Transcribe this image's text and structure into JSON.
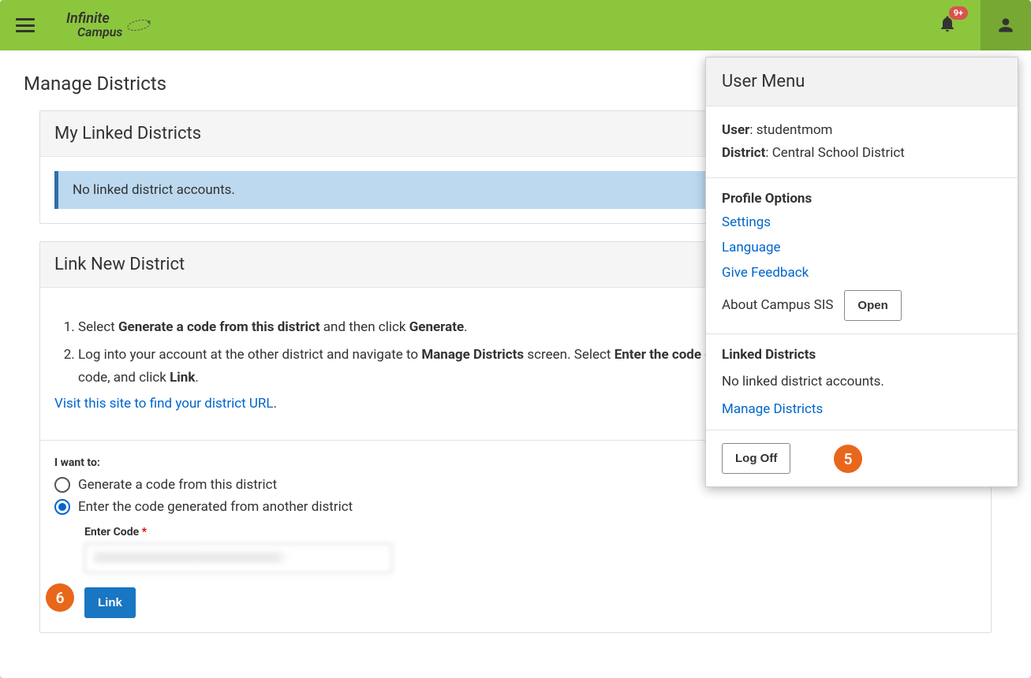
{
  "header": {
    "logo_top": "Infinite",
    "logo_bottom": "Campus",
    "badge": "9+"
  },
  "page_title": "Manage Districts",
  "linked_card": {
    "title": "My Linked Districts",
    "banner": "No linked district accounts."
  },
  "link_new_card": {
    "title": "Link New District",
    "step1_pre": "Select ",
    "step1_b1": "Generate a code from this district",
    "step1_mid": " and then click ",
    "step1_b2": "Generate",
    "step1_post": ".",
    "step2_pre": "Log into your account at the other district and navigate to ",
    "step2_b1": "Manage Districts",
    "step2_mid1": " screen. Select ",
    "step2_b2": "Enter the code generated from another district",
    "step2_mid2": ", enter the code, and click ",
    "step2_b3": "Link",
    "step2_post": ".",
    "visit_link": "Visit this site to find your district URL",
    "visit_post": ".",
    "i_want_to": "I want to:",
    "radio1": "Generate a code from this district",
    "radio2": "Enter the code generated from another district",
    "enter_code_label": "Enter Code ",
    "enter_code_req": "*",
    "code_value": "XXXXXXXXXXXXXXXXXXXXXXXX",
    "link_btn": "Link"
  },
  "user_menu": {
    "title": "User Menu",
    "user_label": "User",
    "user_value": ": studentmom",
    "district_label": "District",
    "district_value": ": Central School District",
    "profile_options": "Profile Options",
    "settings": "Settings",
    "language": "Language",
    "feedback": "Give Feedback",
    "about": "About Campus SIS",
    "open_btn": "Open",
    "linked_title": "Linked Districts",
    "linked_msg": "No linked district accounts.",
    "manage_link": "Manage Districts",
    "log_off": "Log Off"
  },
  "callouts": {
    "c5": "5",
    "c6": "6"
  }
}
